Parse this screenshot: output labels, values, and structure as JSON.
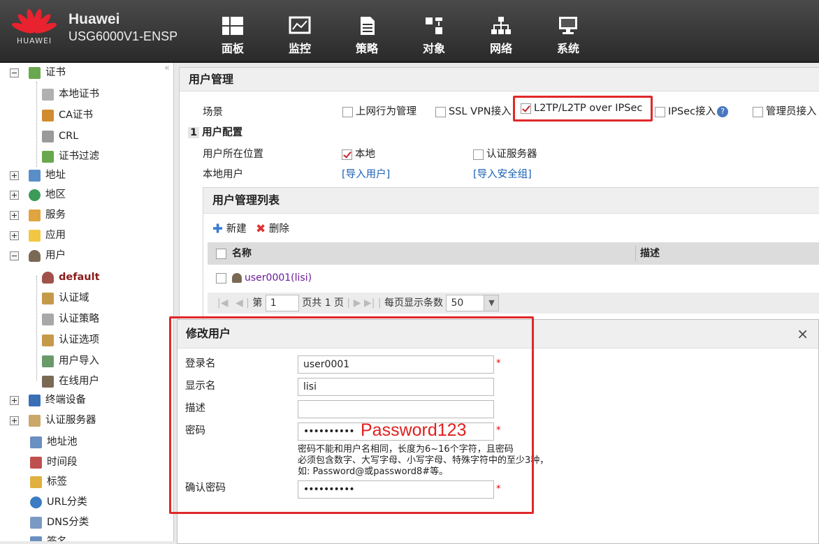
{
  "header": {
    "brand": "Huawei",
    "model": "USG6000V1-ENSP",
    "logo_text": "HUAWEI",
    "nav": [
      {
        "label": "面板",
        "icon": "dashboard-icon"
      },
      {
        "label": "监控",
        "icon": "monitor-icon"
      },
      {
        "label": "策略",
        "icon": "policy-icon"
      },
      {
        "label": "对象",
        "icon": "object-icon"
      },
      {
        "label": "网络",
        "icon": "network-icon"
      },
      {
        "label": "系统",
        "icon": "system-icon"
      }
    ]
  },
  "sidebar": {
    "collapse": "«",
    "items": [
      {
        "label": "证书"
      },
      {
        "label": "本地证书"
      },
      {
        "label": "CA证书"
      },
      {
        "label": "CRL"
      },
      {
        "label": "证书过滤"
      },
      {
        "label": "地址"
      },
      {
        "label": "地区"
      },
      {
        "label": "服务"
      },
      {
        "label": "应用"
      },
      {
        "label": "用户"
      },
      {
        "label": "default"
      },
      {
        "label": "认证域"
      },
      {
        "label": "认证策略"
      },
      {
        "label": "认证选项"
      },
      {
        "label": "用户导入"
      },
      {
        "label": "在线用户"
      },
      {
        "label": "终端设备"
      },
      {
        "label": "认证服务器"
      },
      {
        "label": "地址池"
      },
      {
        "label": "时间段"
      },
      {
        "label": "标签"
      },
      {
        "label": "URL分类"
      },
      {
        "label": "DNS分类"
      },
      {
        "label": "签名"
      }
    ]
  },
  "main": {
    "title": "用户管理",
    "scene_label": "场景",
    "scenes": [
      {
        "label": "上网行为管理",
        "checked": false
      },
      {
        "label": "SSL VPN接入",
        "checked": false
      },
      {
        "label": "L2TP/L2TP over IPSec",
        "checked": true
      },
      {
        "label": "IPSec接入",
        "checked": false
      },
      {
        "label": "管理员接入",
        "checked": false
      }
    ],
    "step_number": "1",
    "user_config_title": "用户配置",
    "location_label": "用户所在位置",
    "location_local": "本地",
    "location_server": "认证服务器",
    "local_user_label": "本地用户",
    "import_users": "[导入用户]",
    "import_groups": "[导入安全组]",
    "list": {
      "title": "用户管理列表",
      "new_btn": "新建",
      "delete_btn": "删除",
      "col_name": "名称",
      "col_desc": "描述",
      "rows": [
        {
          "name": "user0001(lisi)"
        }
      ]
    },
    "pager": {
      "page_prefix": "第",
      "page": "1",
      "total": "页共 1 页",
      "per_page_label": "每页显示条数",
      "per_page": "50"
    }
  },
  "dialog": {
    "title": "修改用户",
    "close": "×",
    "login_label": "登录名",
    "login_value": "user0001",
    "display_label": "显示名",
    "display_value": "lisi",
    "desc_label": "描述",
    "desc_value": "",
    "password_label": "密码",
    "password_mask": "••••••••••",
    "password_annotation": "Password123",
    "hint_lines": [
      "密码不能和用户名相同，长度为6~16个字符，且密码",
      "必须包含数字、大写字母、小写字母、特殊字符中的至少3种，",
      "如: Password@或password8#等。"
    ],
    "confirm_label": "确认密码",
    "confirm_mask": "••••••••••",
    "required_mark": "*"
  }
}
